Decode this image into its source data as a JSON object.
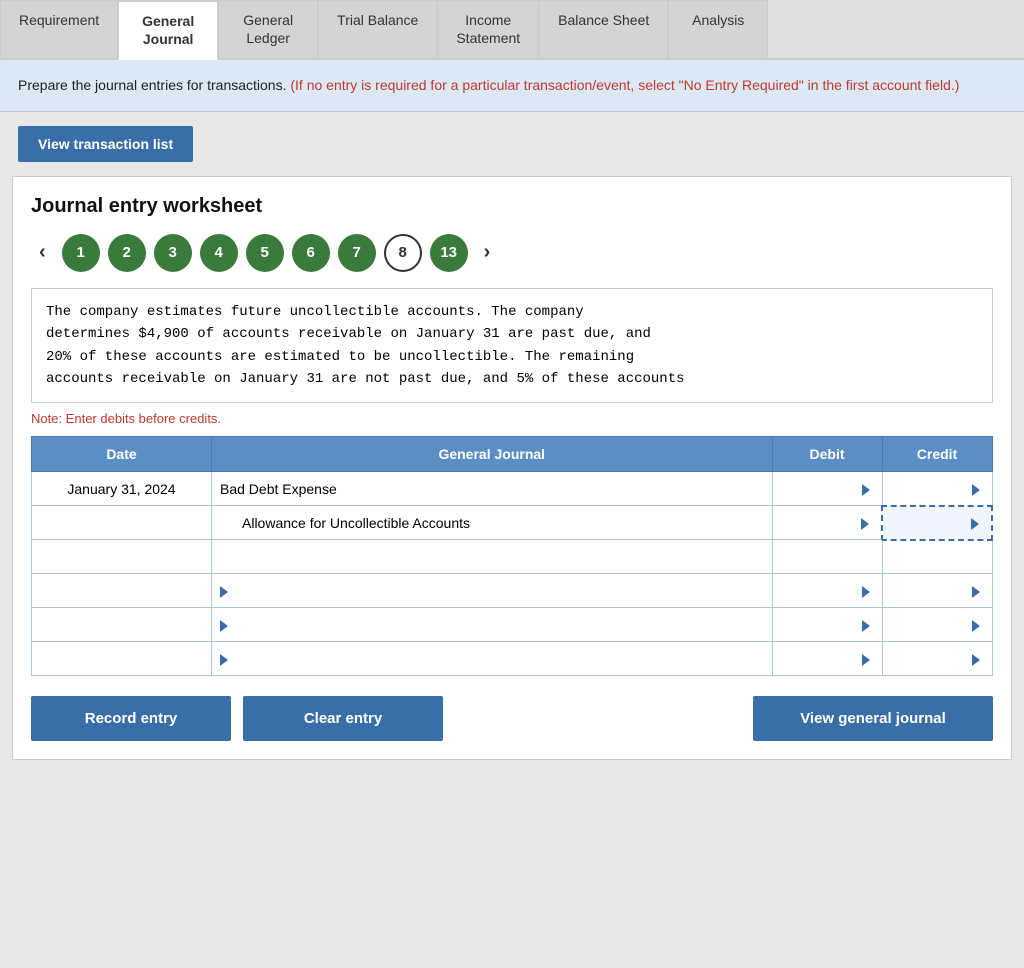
{
  "tabs": [
    {
      "id": "requirement",
      "label": "Requirement",
      "active": false
    },
    {
      "id": "general-journal",
      "label": "General\nJournal",
      "active": true
    },
    {
      "id": "general-ledger",
      "label": "General\nLedger",
      "active": false
    },
    {
      "id": "trial-balance",
      "label": "Trial Balance",
      "active": false
    },
    {
      "id": "income-statement",
      "label": "Income\nStatement",
      "active": false
    },
    {
      "id": "balance-sheet",
      "label": "Balance Sheet",
      "active": false
    },
    {
      "id": "analysis",
      "label": "Analysis",
      "active": false
    }
  ],
  "instruction": {
    "main": "Prepare the journal entries for transactions.",
    "red": " (If no entry is required for a particular transaction/event, select \"No Entry Required\" in the first account field.)"
  },
  "view_transaction_btn": "View transaction list",
  "worksheet": {
    "title": "Journal entry worksheet",
    "steps": [
      {
        "num": "1",
        "active": false
      },
      {
        "num": "2",
        "active": false
      },
      {
        "num": "3",
        "active": false
      },
      {
        "num": "4",
        "active": false
      },
      {
        "num": "5",
        "active": false
      },
      {
        "num": "6",
        "active": false
      },
      {
        "num": "7",
        "active": false
      },
      {
        "num": "8",
        "active": true
      },
      {
        "num": "13",
        "active": false
      }
    ],
    "description": "The company estimates future uncollectible accounts. The company\ndetermines $4,900 of accounts receivable on January 31 are past due, and\n20% of these accounts are estimated to be uncollectible. The remaining\naccounts receivable on January 31 are not past due, and 5% of these accounts",
    "note": "Note: Enter debits before credits.",
    "table": {
      "headers": [
        "Date",
        "General Journal",
        "Debit",
        "Credit"
      ],
      "rows": [
        {
          "date": "January 31, 2024",
          "account": "Bad Debt Expense",
          "indented": false,
          "debit": "",
          "credit": "",
          "has_triangle_debit": true,
          "has_triangle_credit": true,
          "credit_dashed": false
        },
        {
          "date": "",
          "account": "Allowance for Uncollectible Accounts",
          "indented": true,
          "debit": "",
          "credit": "",
          "has_triangle_debit": true,
          "has_triangle_credit": true,
          "credit_dashed": true
        },
        {
          "date": "",
          "account": "",
          "indented": false,
          "debit": "",
          "credit": "",
          "has_triangle_debit": false,
          "has_triangle_credit": false,
          "credit_dashed": false
        },
        {
          "date": "",
          "account": "",
          "indented": false,
          "debit": "",
          "credit": "",
          "has_triangle_debit": true,
          "has_triangle_credit": true,
          "credit_dashed": false
        },
        {
          "date": "",
          "account": "",
          "indented": false,
          "debit": "",
          "credit": "",
          "has_triangle_debit": true,
          "has_triangle_credit": true,
          "credit_dashed": false
        },
        {
          "date": "",
          "account": "",
          "indented": false,
          "debit": "",
          "credit": "",
          "has_triangle_debit": true,
          "has_triangle_credit": true,
          "credit_dashed": false
        }
      ]
    },
    "buttons": {
      "record": "Record entry",
      "clear": "Clear entry",
      "view_journal": "View general journal"
    }
  }
}
